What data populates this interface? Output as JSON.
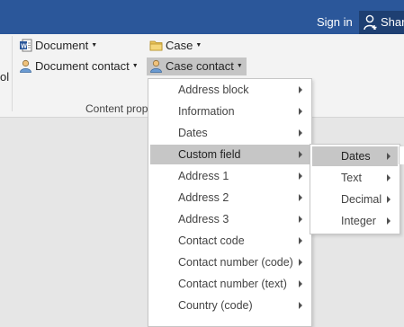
{
  "titlebar": {
    "signin_label": "Sign in",
    "share_label": "Share",
    "share_icon": "person-add-icon"
  },
  "ribbon": {
    "left_fragment": "ol",
    "group_label": "Content prop",
    "document_label": "Document",
    "document_contact_label": "Document contact",
    "case_label": "Case",
    "case_contact_label": "Case contact"
  },
  "menu": {
    "items": [
      "Address block",
      "Information",
      "Dates",
      "Custom field",
      "Address 1",
      "Address 2",
      "Address 3",
      "Contact code",
      "Contact number (code)",
      "Contact number (text)",
      "Country (code)"
    ],
    "highlighted": "Custom field"
  },
  "submenu": {
    "items": [
      "Dates",
      "Text",
      "Decimal",
      "Integer"
    ],
    "highlighted": "Dates"
  },
  "colors": {
    "titlebar": "#2b579a",
    "highlight": "#c6c6c6",
    "ribbon": "#f3f3f3"
  }
}
